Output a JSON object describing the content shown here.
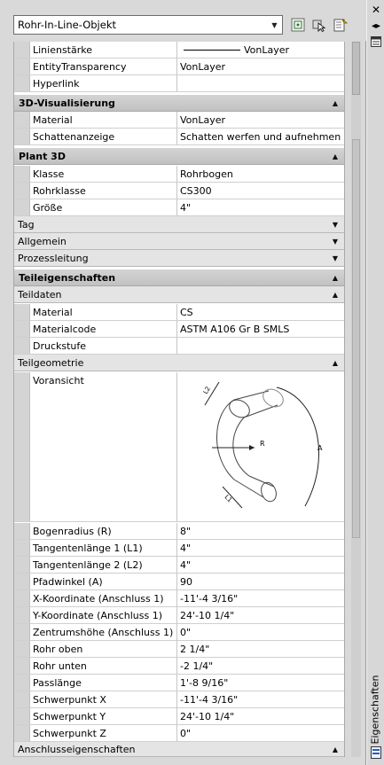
{
  "object_selector": {
    "value": "Rohr-In-Line-Objekt"
  },
  "sidebar": {
    "title": "Eigenschaften"
  },
  "rows": {
    "linienstaerke": {
      "name": "Linienstärke",
      "value": "VonLayer"
    },
    "transparency": {
      "name": "EntityTransparency",
      "value": "VonLayer"
    },
    "hyperlink": {
      "name": "Hyperlink",
      "value": ""
    }
  },
  "categories": {
    "vis3d": "3D-Visualisierung",
    "plant3d": "Plant 3D",
    "tag": "Tag",
    "allgemein": "Allgemein",
    "prozess": "Prozessleitung",
    "teileig": "Teileigenschaften",
    "teildaten": "Teildaten",
    "teilgeo": "Teilgeometrie",
    "anschluss": "Anschlusseigenschaften"
  },
  "vis3d": {
    "material": {
      "name": "Material",
      "value": "VonLayer"
    },
    "schatten": {
      "name": "Schattenanzeige",
      "value": "Schatten werfen und aufnehmen"
    }
  },
  "plant3d": {
    "klasse": {
      "name": "Klasse",
      "value": "Rohrbogen"
    },
    "rohrklasse": {
      "name": "Rohrklasse",
      "value": "CS300"
    },
    "groesse": {
      "name": "Größe",
      "value": "4\""
    }
  },
  "teildaten": {
    "material": {
      "name": "Material",
      "value": "CS"
    },
    "materialcode": {
      "name": "Materialcode",
      "value": "ASTM A106 Gr B SMLS"
    },
    "druckstufe": {
      "name": "Druckstufe",
      "value": ""
    }
  },
  "preview": {
    "name": "Voransicht",
    "labels": {
      "l1": "L1",
      "l2": "L2",
      "r": "R",
      "a": "A"
    }
  },
  "teilgeo": {
    "bogenradius": {
      "name": "Bogenradius (R)",
      "value": "8\""
    },
    "tl1": {
      "name": "Tangentenlänge 1 (L1)",
      "value": "4\""
    },
    "tl2": {
      "name": "Tangentenlänge 2 (L2)",
      "value": "4\""
    },
    "pfad": {
      "name": "Pfadwinkel (A)",
      "value": "90"
    },
    "xkoord": {
      "name": "X-Koordinate (Anschluss 1)",
      "value": "-11'-4 3/16\""
    },
    "ykoord": {
      "name": "Y-Koordinate (Anschluss 1)",
      "value": "24'-10 1/4\""
    },
    "zentrum": {
      "name": "Zentrumshöhe (Anschluss 1)",
      "value": "0\""
    },
    "oben": {
      "name": "Rohr oben",
      "value": "2 1/4\""
    },
    "unten": {
      "name": "Rohr unten",
      "value": "-2 1/4\""
    },
    "pass": {
      "name": "Passlänge",
      "value": "1'-8 9/16\""
    },
    "sx": {
      "name": "Schwerpunkt X",
      "value": "-11'-4 3/16\""
    },
    "sy": {
      "name": "Schwerpunkt Y",
      "value": "24'-10 1/4\""
    },
    "sz": {
      "name": "Schwerpunkt Z",
      "value": "0\""
    }
  }
}
